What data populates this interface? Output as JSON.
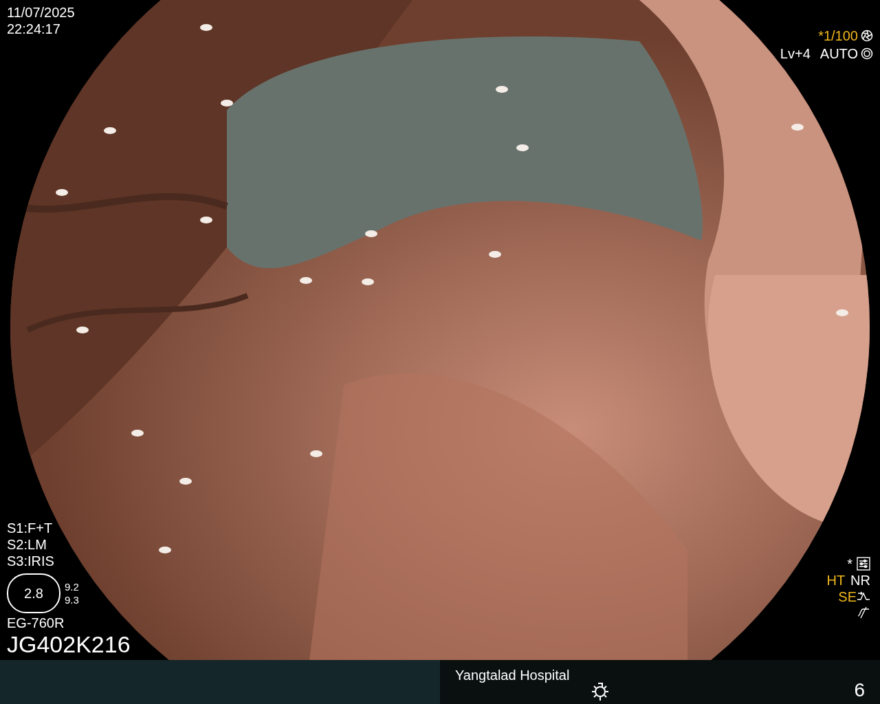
{
  "date": "11/07/2025",
  "time": "22:24:17",
  "shutter": "*1/100",
  "exposure": {
    "level": "Lv+4",
    "mode": "AUTO"
  },
  "switches": [
    "S1:F+T",
    "S2:LM",
    "S3:IRIS"
  ],
  "zoom_gauge": {
    "center": "2.8",
    "readings": [
      "9.2",
      "9.3"
    ]
  },
  "scope_model": "EG-760R",
  "serial": "JG402K216",
  "settings_mark": "*",
  "flags": [
    {
      "text": "HT",
      "color": "#f2b81c"
    },
    {
      "text": "NR",
      "color": "#ffffff"
    }
  ],
  "enhancement": {
    "text": "SE",
    "color": "#f2b81c"
  },
  "footer": {
    "hospital": "Yangtalad Hospital",
    "number": "6"
  }
}
